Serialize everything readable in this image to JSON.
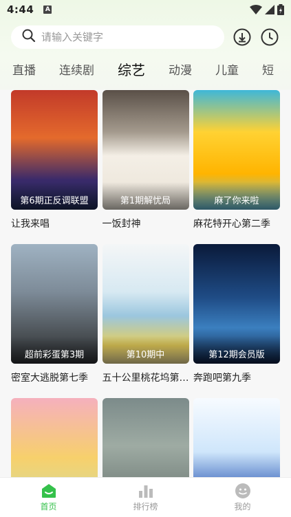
{
  "status_bar": {
    "time": "4:44",
    "sim_label": "A"
  },
  "search": {
    "placeholder": "请输入关键字"
  },
  "tabs": [
    {
      "label": "直播"
    },
    {
      "label": "连续剧"
    },
    {
      "label": "综艺",
      "active": true
    },
    {
      "label": "动漫"
    },
    {
      "label": "儿童"
    },
    {
      "label": "短"
    }
  ],
  "cards": [
    {
      "title": "让我来唱",
      "badge": "第6期正反调联盟"
    },
    {
      "title": "一饭封神",
      "badge": "第1期解忧局"
    },
    {
      "title": "麻花特开心第二季",
      "badge": "麻了你来啦"
    },
    {
      "title": "密室大逃脱第七季",
      "badge": "超前彩蛋第3期"
    },
    {
      "title": "五十公里桃花坞第五季",
      "badge": "第10期中"
    },
    {
      "title": "奔跑吧第九季",
      "badge": "第12期会员版"
    },
    {
      "title": "",
      "badge": ""
    },
    {
      "title": "",
      "badge": ""
    },
    {
      "title": "",
      "badge": ""
    }
  ],
  "bottom_nav": [
    {
      "label": "首页",
      "icon": "home-icon",
      "active": true
    },
    {
      "label": "排行榜",
      "icon": "ranking-icon"
    },
    {
      "label": "我的",
      "icon": "profile-icon"
    }
  ],
  "colors": {
    "accent": "#35c14b"
  }
}
